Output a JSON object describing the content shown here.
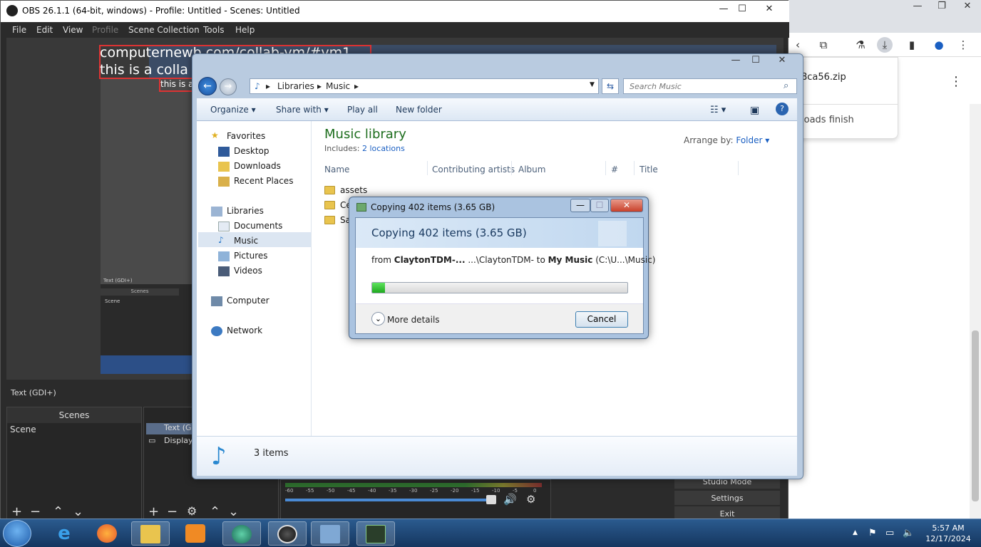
{
  "obs": {
    "title": "OBS 26.1.1 (64-bit, windows) - Profile: Untitled - Scenes: Untitled",
    "menu": [
      "File",
      "Edit",
      "View",
      "Profile",
      "Scene Collection",
      "Tools",
      "Help"
    ],
    "preview_text_1": "computernewb.com/collab-vm/#vm1",
    "preview_text_2": "this is a colla",
    "preview_text_3": "this is a",
    "source_label": "Text (GDI+)",
    "nested_source_label": "Text (GDI+)",
    "scenes_header": "Scenes",
    "scene_item": "Scene",
    "sources_item_1": "Text (G",
    "sources_item_2": "Display",
    "mini_scenes_header": "Scenes",
    "mini_scene_item": "Scene",
    "audio_ticks": [
      "-60",
      "-55",
      "-50",
      "-45",
      "-40",
      "-35",
      "-30",
      "-25",
      "-20",
      "-15",
      "-10",
      "-5",
      "0"
    ],
    "controls": [
      "Studio Mode",
      "Settings",
      "Exit"
    ]
  },
  "chrome": {
    "download_filename": "8ca56.zip",
    "download_message": "loads finish"
  },
  "explorer": {
    "breadcrumb": [
      "Libraries",
      "Music"
    ],
    "search_placeholder": "Search Music",
    "commands": [
      "Organize",
      "Share with",
      "Play all",
      "New folder"
    ],
    "nav": {
      "favorites": "Favorites",
      "favorites_items": [
        "Desktop",
        "Downloads",
        "Recent Places"
      ],
      "libraries": "Libraries",
      "libraries_items": [
        "Documents",
        "Music",
        "Pictures",
        "Videos"
      ],
      "computer": "Computer",
      "network": "Network"
    },
    "library_title": "Music library",
    "includes_label": "Includes:",
    "includes_link": "2 locations",
    "arrange_label": "Arrange by:",
    "arrange_value": "Folder",
    "columns": [
      "Name",
      "Contributing artists",
      "Album",
      "#",
      "Title"
    ],
    "files": [
      "assets",
      "Ce",
      "Sa"
    ],
    "status": "3 items"
  },
  "copy_dialog": {
    "title": "Copying 402 items (3.65 GB)",
    "heading": "Copying 402 items (3.65 GB)",
    "from_label": "from",
    "from_source": "ClaytonTDM-...",
    "from_path": "...\\ClaytonTDM-",
    "to_label": "to",
    "to_dest": "My Music",
    "to_path": "(C:\\U...\\Music)",
    "progress_fraction": 0.05,
    "more_details": "More details",
    "cancel": "Cancel"
  },
  "taskbar": {
    "time": "5:57 AM",
    "date": "12/17/2024"
  },
  "colors": {
    "obs_bg": "#2b2b2b",
    "library_title": "#1e6e1e",
    "link": "#1a5fc2",
    "progress": "#1faa1f"
  }
}
